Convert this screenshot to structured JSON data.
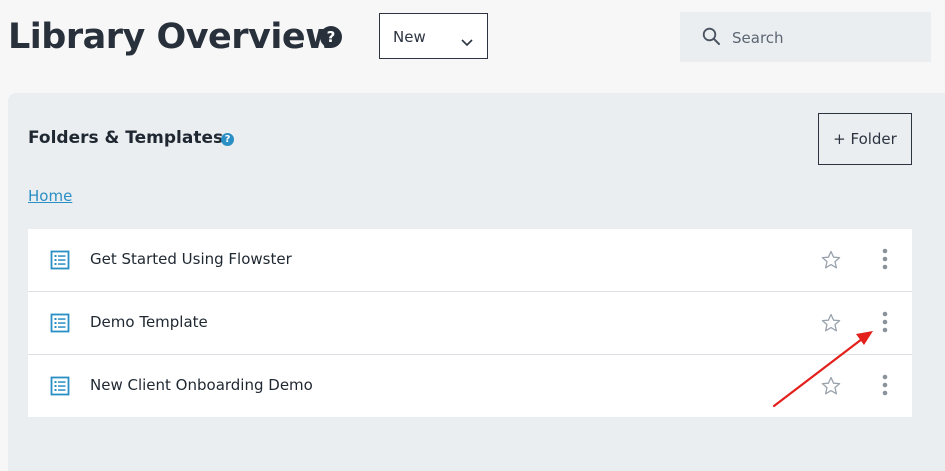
{
  "header": {
    "title": "Library Overview",
    "help_glyph": "?",
    "new_select": {
      "selected": "New"
    },
    "search": {
      "placeholder": "Search",
      "value": ""
    }
  },
  "panel": {
    "title": "Folders & Templates",
    "help_glyph": "?",
    "folder_button": "+ Folder",
    "breadcrumb": "Home"
  },
  "items": [
    {
      "label": "Get Started Using Flowster",
      "icon": "document-list-icon"
    },
    {
      "label": "Demo Template",
      "icon": "document-list-icon"
    },
    {
      "label": "New Client Onboarding Demo",
      "icon": "document-list-icon"
    }
  ],
  "colors": {
    "accent": "#2a8fc4",
    "annotation_arrow": "#e3201b",
    "panel_bg": "#ebeef1",
    "text_dark": "#28313b"
  }
}
